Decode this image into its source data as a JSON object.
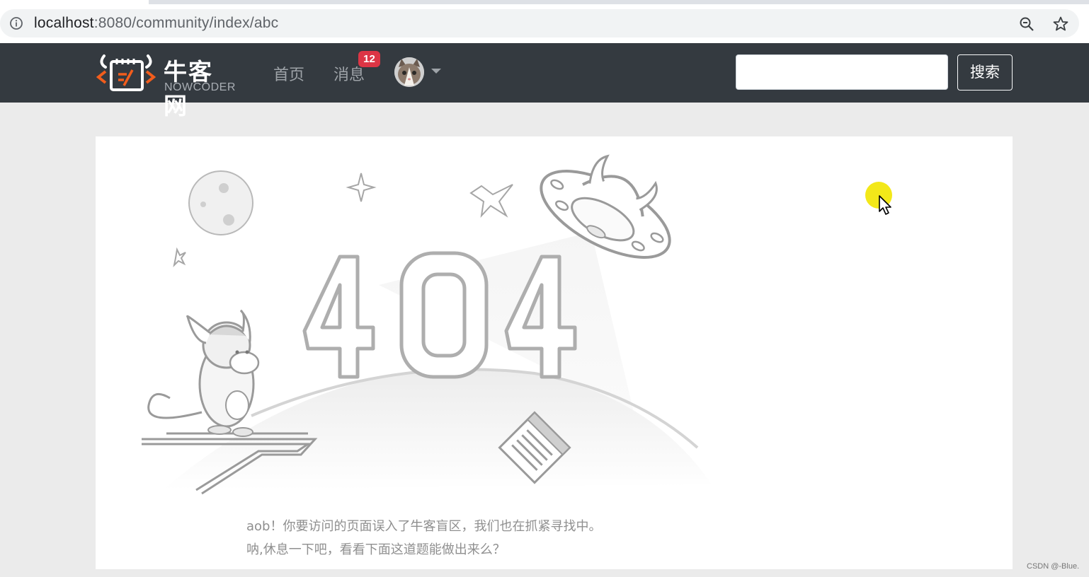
{
  "browser": {
    "url_host": "localhost",
    "url_rest": ":8080/community/index/abc"
  },
  "navbar": {
    "logo_cn": "牛客网",
    "logo_en": "NOWCODER",
    "home": "首页",
    "messages": "消息",
    "message_badge": "12",
    "search_placeholder": "",
    "search_button": "搜索"
  },
  "error_page": {
    "code": "404",
    "line1": "aob！你要访问的页面误入了牛客盲区，我们也在抓紧寻找中。",
    "line2": "呐,休息一下吧，看看下面这道题能做出来么？"
  },
  "watermark": "CSDN @-Blue.",
  "colors": {
    "navbar_bg": "#343a40",
    "badge": "#dc3545",
    "logo_accent": "#f25d1c"
  }
}
